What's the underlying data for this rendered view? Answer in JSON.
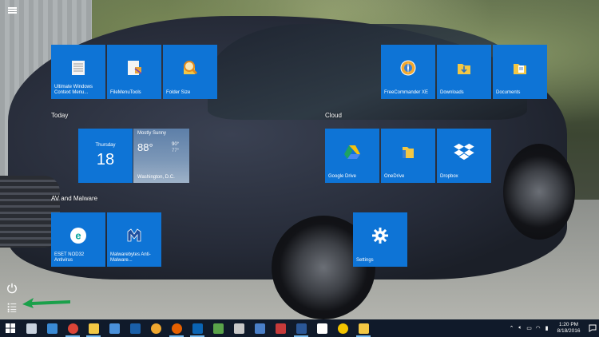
{
  "groups": {
    "today": "Today",
    "cloud": "Cloud",
    "av": "AV and Malware"
  },
  "tiles": {
    "ultimate_windows": "Ultimate Windows Context Menu...",
    "filemenutools": "FileMenuTools",
    "folder_size": "Folder Size",
    "freecommander": "FreeCommander XE",
    "downloads": "Downloads",
    "documents": "Documents",
    "google_drive": "Google Drive",
    "onedrive": "OneDrive",
    "dropbox": "Dropbox",
    "eset": "ESET NOD32 Antivirus",
    "malwarebytes": "Malwarebytes Anti-Malware...",
    "settings": "Settings"
  },
  "calendar": {
    "day": "Thursday",
    "date": "18"
  },
  "weather": {
    "condition": "Mostly Sunny",
    "temp": "88°",
    "high": "90°",
    "low": "77°",
    "location": "Washington, D.C."
  },
  "taskbar": {
    "icons": [
      {
        "name": "task-view-icon",
        "color": "#c9d3df"
      },
      {
        "name": "control-panel-icon",
        "color": "#3a8ad4"
      },
      {
        "name": "chrome-icon",
        "color": "#db4437"
      },
      {
        "name": "file-explorer-icon",
        "color": "#f2c744"
      },
      {
        "name": "store-icon",
        "color": "#4a90d9"
      },
      {
        "name": "edge-icon",
        "color": "#1a5fa8"
      },
      {
        "name": "freecommander-icon",
        "color": "#f0a830"
      },
      {
        "name": "firefox-icon",
        "color": "#e66000"
      },
      {
        "name": "outlook-icon",
        "color": "#0a64b4"
      },
      {
        "name": "notepad-icon",
        "color": "#5aa34a"
      },
      {
        "name": "sound-recorder-icon",
        "color": "#c8c8c8"
      },
      {
        "name": "windows-media-icon",
        "color": "#4a7fc8"
      },
      {
        "name": "wordpad-icon",
        "color": "#c63a3a"
      },
      {
        "name": "word-icon",
        "color": "#2b5797"
      },
      {
        "name": "settings-icon",
        "color": "#ffffff"
      },
      {
        "name": "norton-icon",
        "color": "#f2c400"
      },
      {
        "name": "folder-icon",
        "color": "#f2c744"
      }
    ],
    "time": "1:20 PM",
    "date": "8/18/2016"
  },
  "colors": {
    "tile_blue": "#0e74d6",
    "taskbar": "#101a2a",
    "arrow": "#1aa04a"
  }
}
